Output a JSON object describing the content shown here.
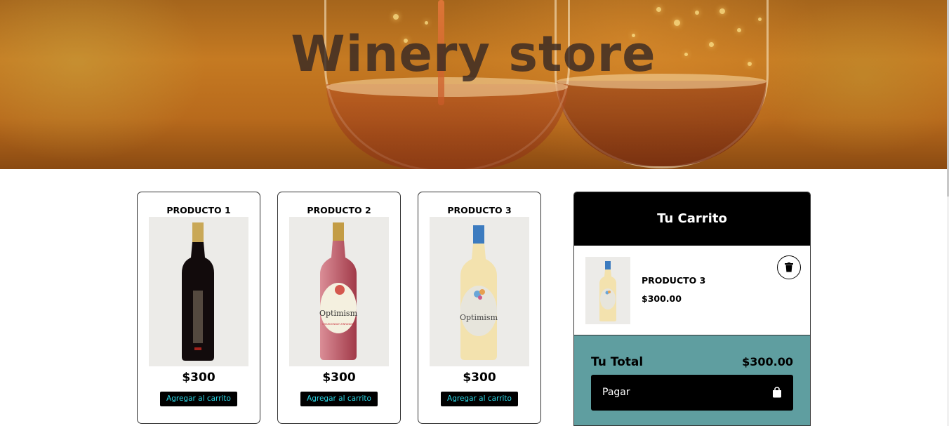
{
  "hero": {
    "title": "Winery store"
  },
  "products": [
    {
      "name": "PRODUCTO 1",
      "price": "$300",
      "button_label": "Agregar al carrito",
      "bottle": "dark-red-wine-bottle"
    },
    {
      "name": "PRODUCTO 2",
      "price": "$300",
      "button_label": "Agregar al carrito",
      "bottle": "rose-wine-bottle",
      "label_text": "Optimism",
      "label_sub": "CHARDONNAY ZINFANDEL"
    },
    {
      "name": "PRODUCTO 3",
      "price": "$300",
      "button_label": "Agregar al carrito",
      "bottle": "white-wine-bottle",
      "label_text": "Optimism"
    }
  ],
  "cart": {
    "title": "Tu Carrito",
    "items": [
      {
        "name": "PRODUCTO 3",
        "price": "$300.00"
      }
    ],
    "total_label": "Tu Total",
    "total_value": "$300.00",
    "pay_label": "Pagar"
  },
  "colors": {
    "cart_footer": "#5f9ea0",
    "button_text": "#2cd9e8",
    "header_bg": "#000000"
  },
  "icons": [
    "trash-icon",
    "shopping-bag-icon"
  ]
}
